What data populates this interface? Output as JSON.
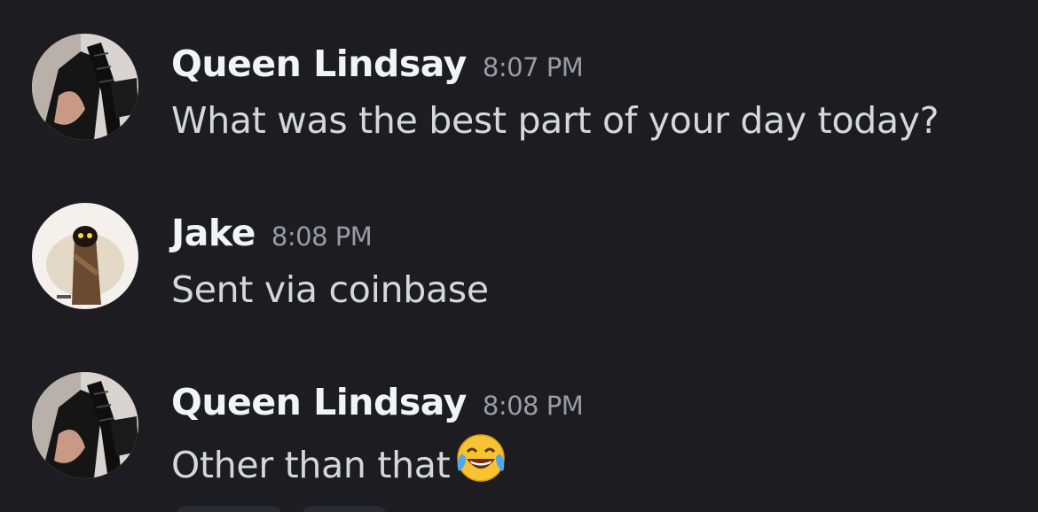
{
  "messages": [
    {
      "author": "Queen Lindsay",
      "time": "8:07 PM",
      "text": "What was the best part of your day today?",
      "avatar_icon": "user-avatar-photo"
    },
    {
      "author": "Jake",
      "time": "8:08 PM",
      "text": "Sent via coinbase",
      "avatar_icon": "hooded-figure-avatar"
    },
    {
      "author": "Queen Lindsay",
      "time": "8:08 PM",
      "text": "Other than that",
      "emoji": "face-with-tears-of-joy-icon",
      "avatar_icon": "user-avatar-photo"
    }
  ],
  "colors": {
    "background": "#1c1c21",
    "author": "#f2f3f5",
    "timestamp": "#9a9ba3",
    "text": "#d6d7dc"
  }
}
